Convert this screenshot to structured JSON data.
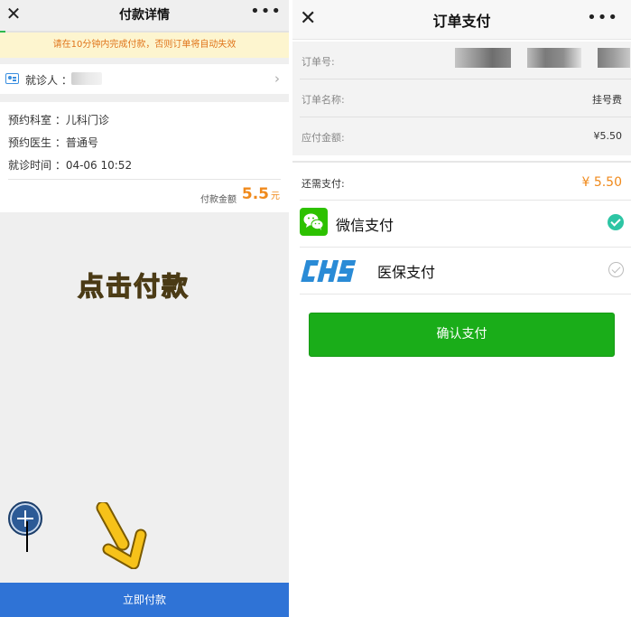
{
  "left": {
    "nav": {
      "close": "✕",
      "title": "付款详情",
      "more": "•••"
    },
    "progress": 0.02,
    "notice": "请在10分钟内完成付款，否则订单将自动失效",
    "patient": {
      "label": "就诊人 ："
    },
    "info": {
      "department": "预约科室 ：儿科门诊",
      "doctor": "预约医生 ：普通号",
      "time": "就诊时间 ：04-06 10:52",
      "pay_label": "付款金额",
      "pay_amount": "5.5",
      "pay_unit": "元"
    },
    "headline": "点击付款",
    "pay_button": "立即付款"
  },
  "right": {
    "nav": {
      "close": "✕",
      "title": "订单支付",
      "more": "•••"
    },
    "order": {
      "number_label": "订单号:",
      "name_label": "订单名称:",
      "name_value": "挂号费",
      "amount_label": "应付金额:",
      "amount_value": "¥5.50"
    },
    "remain": {
      "label": "还需支付:",
      "value": "¥ 5.50"
    },
    "methods": [
      {
        "label": "微信支付",
        "icon": "wechat-pay-icon",
        "selected": true
      },
      {
        "label": "医保支付",
        "icon": "chs-logo",
        "selected": false
      }
    ],
    "confirm_button": "确认支付"
  },
  "colors": {
    "accent_orange": "#f08a1c",
    "pay_blue": "#2f73d6",
    "wechat_green": "#1aad19",
    "headline_yellow": "#f6c428"
  }
}
